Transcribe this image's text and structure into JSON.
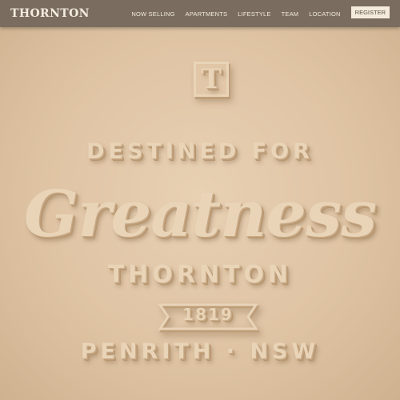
{
  "header": {
    "logo": "THORNTON",
    "nav": [
      "NOW SELLING",
      "APARTMENTS",
      "LIFESTYLE",
      "TEAM",
      "LOCATION"
    ],
    "register_label": "REGISTER"
  },
  "hero": {
    "monogram": "T",
    "tagline": "DESTINED FOR",
    "headline": "Greatness",
    "project_name": "THORNTON",
    "year": "1819",
    "location": "PENRITH · NSW"
  },
  "colors": {
    "navbar": "#7a6d5f",
    "background": "#dfc4a4",
    "embossed_text": "#e9d4b8",
    "register_button": "#f5ebdc"
  }
}
